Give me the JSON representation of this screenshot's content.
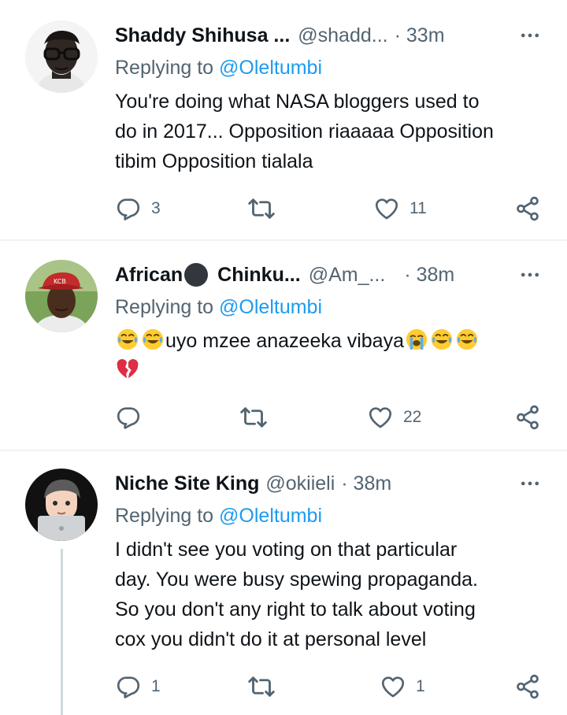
{
  "tweets": [
    {
      "name": "Shaddy Shihusa ...",
      "handle": "@shadd...",
      "time": "· 33m",
      "replying_prefix": "Replying to ",
      "replying_to": "@Oleltumbi",
      "lines": [
        "You're doing what NASA bloggers used to",
        "do in 2017... Opposition riaaaaa Opposition",
        "tibim Opposition tialala"
      ],
      "replies": "3",
      "retweets": "",
      "likes": "11"
    },
    {
      "name_part1": "African",
      "name_part2": "Chinku...",
      "handle": "@Am_...",
      "time": "· 38m",
      "replying_prefix": "Replying to ",
      "replying_to": "@Oleltumbi",
      "text_mid": "uyo mzee anazeeka vibaya",
      "emojis_line1": [
        "joy",
        "joy",
        "sob",
        "joy",
        "joy"
      ],
      "emojis_line2": [
        "broken-heart"
      ],
      "replies": "",
      "retweets": "",
      "likes": "22"
    },
    {
      "name": "Niche Site King",
      "handle": "@okiieli",
      "time": "· 38m",
      "replying_prefix": "Replying to ",
      "replying_to": "@Oleltumbi",
      "lines": [
        "I didn't see you voting on that particular",
        "day. You were busy spewing propaganda.",
        "So you don't any right to talk about voting",
        "cox you didn't do it at personal level"
      ],
      "replies": "1",
      "retweets": "",
      "likes": "1"
    }
  ],
  "colors": {
    "accent": "#1d9bf0",
    "secondary_text": "#536471",
    "primary_text": "#0f1419",
    "divider": "#eff3f4"
  },
  "icons": [
    "more-icon",
    "reply-icon",
    "retweet-icon",
    "like-icon",
    "share-icon"
  ]
}
